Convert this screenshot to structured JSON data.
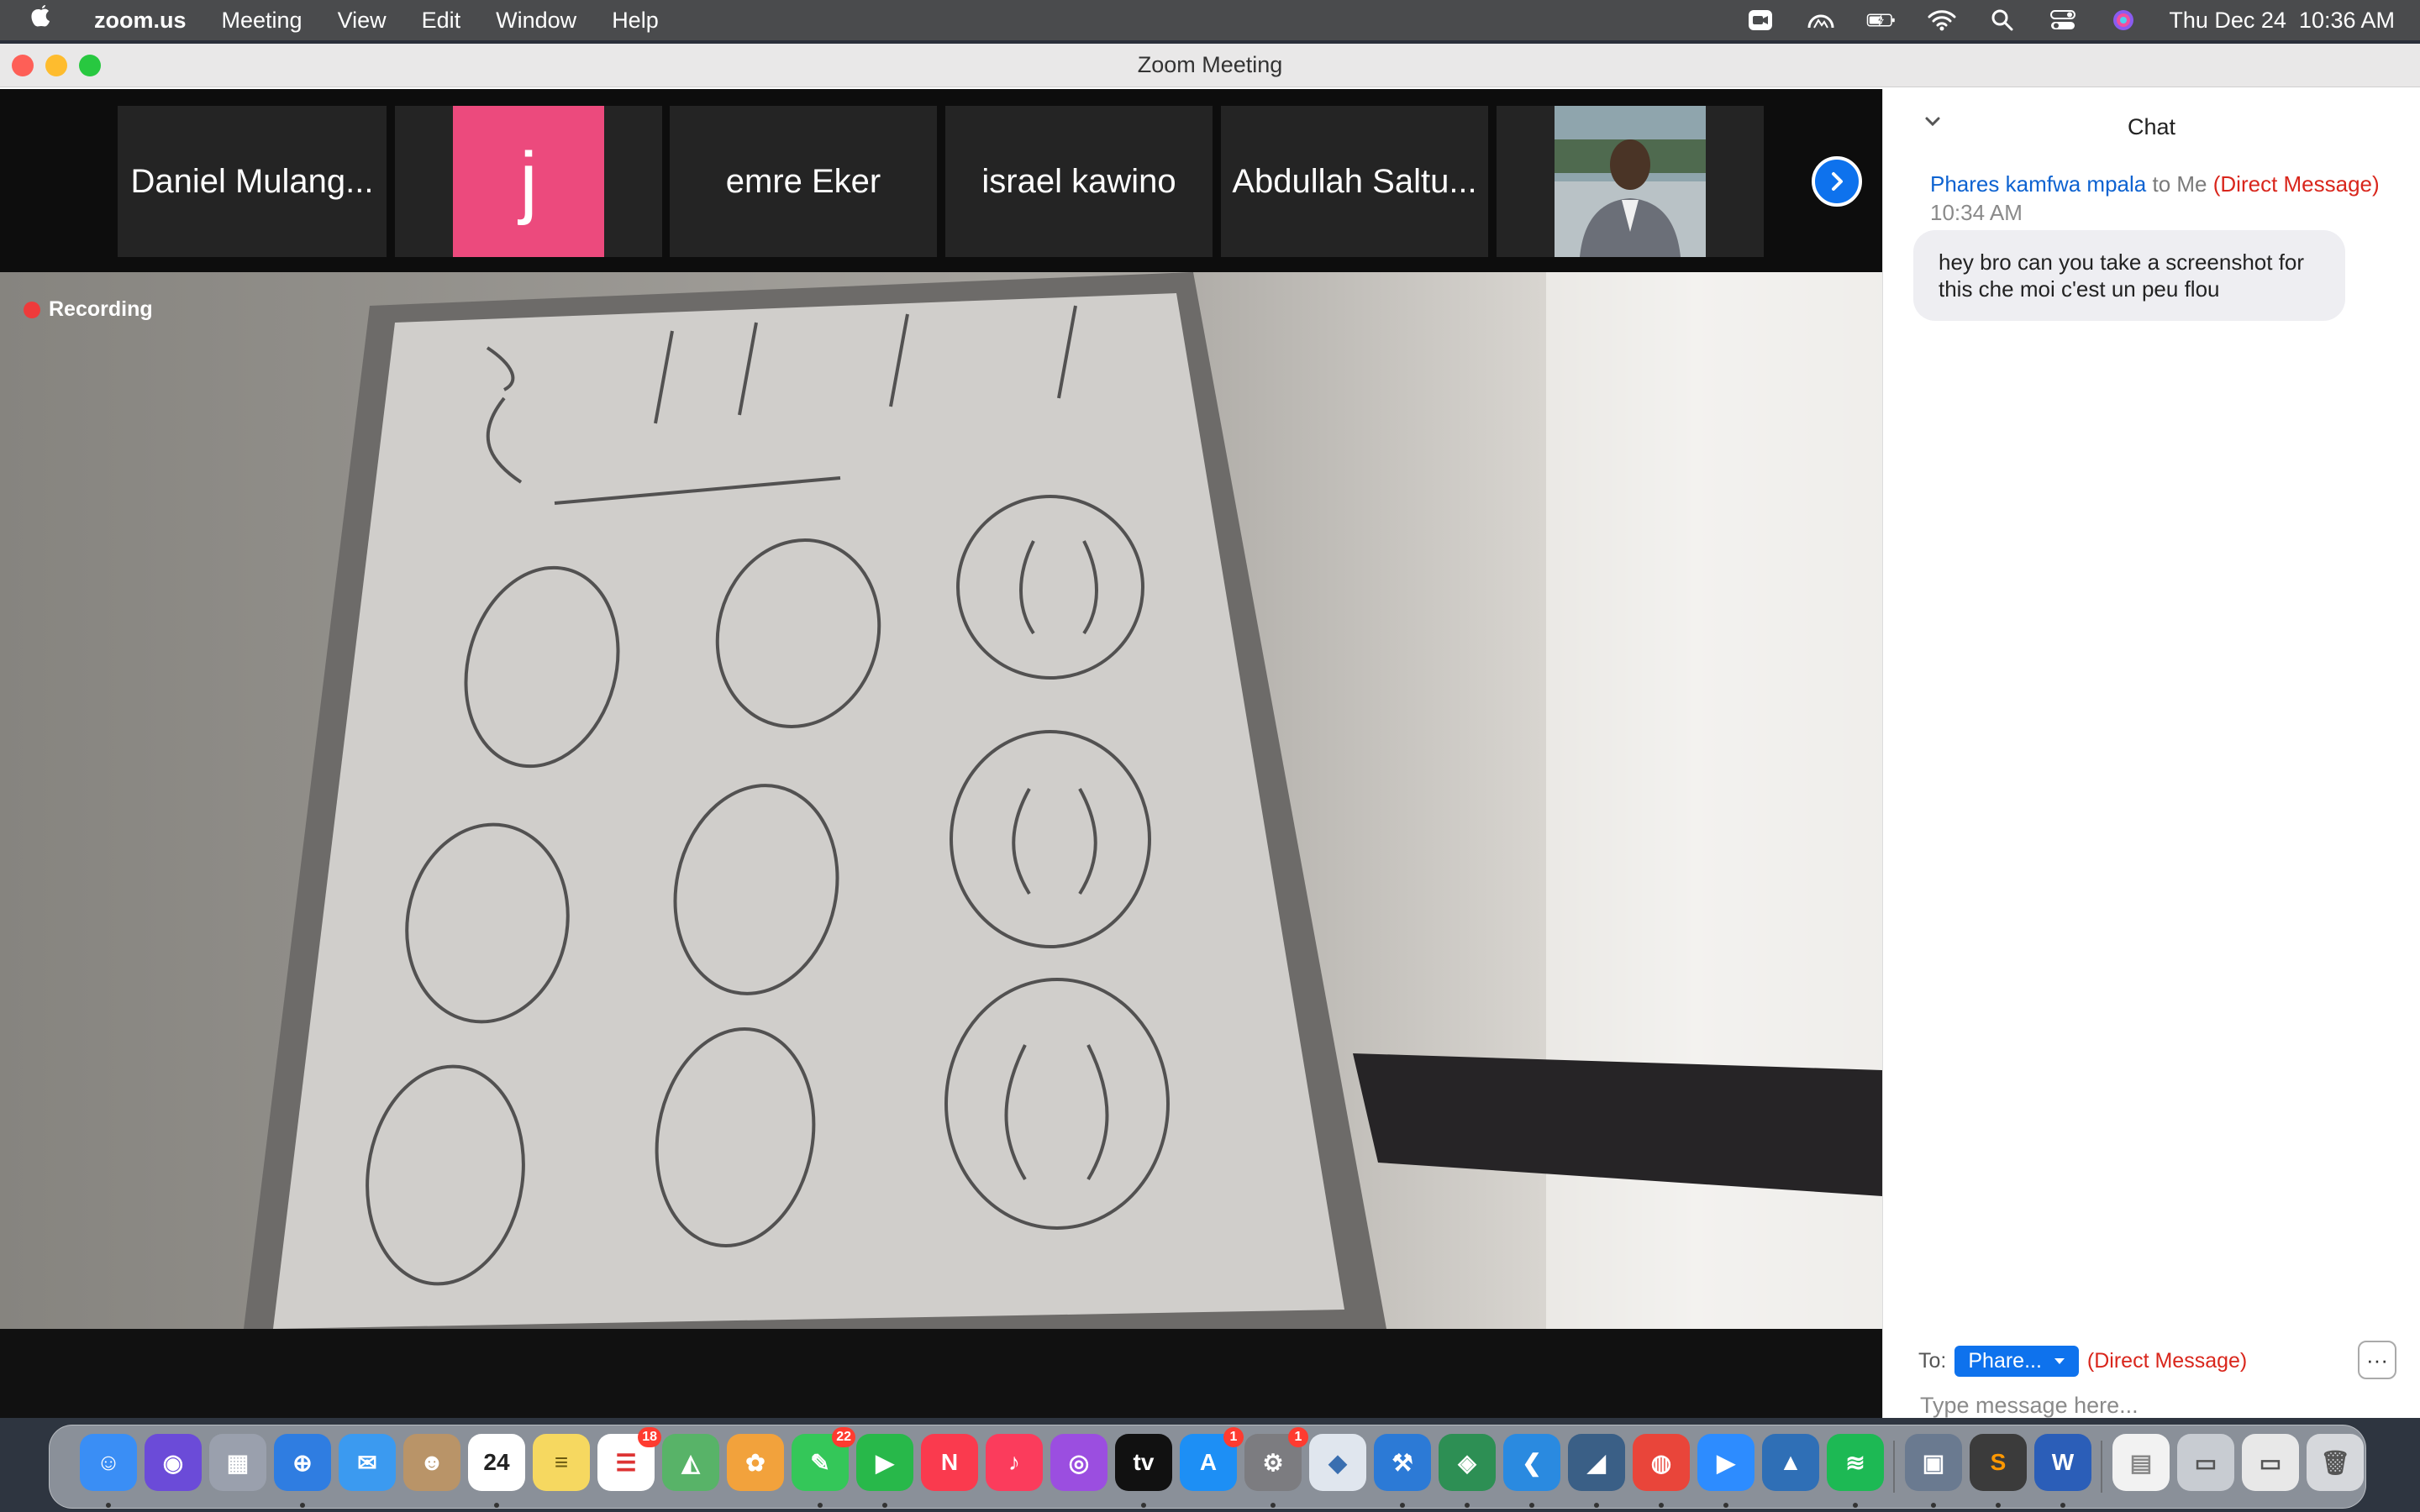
{
  "menubar": {
    "app_name": "zoom.us",
    "menus": [
      "Meeting",
      "View",
      "Edit",
      "Window",
      "Help"
    ],
    "datetime": "Thu Dec 24  10:36 AM"
  },
  "window": {
    "title": "Zoom Meeting"
  },
  "participants": [
    {
      "name": "Daniel Mulang..."
    },
    {
      "avatar_letter": "j",
      "avatar_color": "#ec4a7d"
    },
    {
      "name": "emre Eker"
    },
    {
      "name": "israel kawino"
    },
    {
      "name": "Abdullah Saltu..."
    }
  ],
  "video": {
    "recording_label": "Recording"
  },
  "chat": {
    "title": "Chat",
    "sender": "Phares kamfwa mpala",
    "to_me": "to Me",
    "direct": "(Direct Message)",
    "time": "10:34 AM",
    "message": "hey bro can you take a screenshot for this che moi c'est un peu flou",
    "to_label": "To:",
    "to_value": "Phare...",
    "to_direct": "(Direct Message)",
    "more": "···",
    "input_placeholder": "Type message here..."
  },
  "dock": {
    "items": [
      {
        "name": "finder",
        "color": "#3a8ef5",
        "glyph": "☺"
      },
      {
        "name": "siri",
        "color": "#6b4bd8",
        "glyph": "◉"
      },
      {
        "name": "launchpad",
        "color": "#9aa0ad",
        "glyph": "▦"
      },
      {
        "name": "safari",
        "color": "#2f7de1",
        "glyph": "⊕"
      },
      {
        "name": "mail",
        "color": "#3b9af0",
        "glyph": "✉"
      },
      {
        "name": "contacts",
        "color": "#b99468",
        "glyph": "☻"
      },
      {
        "name": "calendar",
        "color": "#ffffff",
        "glyph": "24",
        "text_color": "#222"
      },
      {
        "name": "notes",
        "color": "#f6d860",
        "glyph": "≡",
        "text_color": "#6b5a10"
      },
      {
        "name": "reminders",
        "color": "#ffffff",
        "glyph": "☰",
        "text_color": "#d33",
        "badge": "18"
      },
      {
        "name": "maps",
        "color": "#58b368",
        "glyph": "◭"
      },
      {
        "name": "photos",
        "color": "#f2a23c",
        "glyph": "✿"
      },
      {
        "name": "messages",
        "color": "#34c759",
        "glyph": "✎",
        "badge": "22"
      },
      {
        "name": "facetime",
        "color": "#28b84a",
        "glyph": "▶"
      },
      {
        "name": "news",
        "color": "#fa3a4e",
        "glyph": "N"
      },
      {
        "name": "music",
        "color": "#fb3c5c",
        "glyph": "♪"
      },
      {
        "name": "podcasts",
        "color": "#9b4ee0",
        "glyph": "◎"
      },
      {
        "name": "tv",
        "color": "#111111",
        "glyph": "tv"
      },
      {
        "name": "app-store",
        "color": "#1d8ff5",
        "glyph": "A",
        "badge": "1"
      },
      {
        "name": "system-preferences",
        "color": "#7c7c80",
        "glyph": "⚙",
        "badge": "1"
      },
      {
        "name": "virtualbox",
        "color": "#e0e6ee",
        "glyph": "◆",
        "text_color": "#3a6fb0"
      },
      {
        "name": "xcode",
        "color": "#2c7ad6",
        "glyph": "⚒"
      },
      {
        "name": "android-studio",
        "color": "#2d8f54",
        "glyph": "◈"
      },
      {
        "name": "vscode",
        "color": "#2a8ae0",
        "glyph": "❮"
      },
      {
        "name": "mysql-workbench",
        "color": "#3a5f86",
        "glyph": "◢"
      },
      {
        "name": "chrome",
        "color": "#e9453a",
        "glyph": "◍"
      },
      {
        "name": "zoom",
        "color": "#2d8cff",
        "glyph": "▶"
      },
      {
        "name": "vpn",
        "color": "#2f6fb6",
        "glyph": "▲"
      },
      {
        "name": "spotify",
        "color": "#1db954",
        "glyph": "≋"
      },
      {
        "name": "preview",
        "color": "#6a7a90",
        "glyph": "▣"
      },
      {
        "name": "sublime-text",
        "color": "#3b3b3b",
        "glyph": "S",
        "text_color": "#ff9800"
      },
      {
        "name": "word",
        "color": "#2b5eb8",
        "glyph": "W"
      },
      {
        "name": "document",
        "color": "#f2f2f2",
        "glyph": "▤",
        "text_color": "#888"
      },
      {
        "name": "screenshot",
        "color": "#c8ccd2",
        "glyph": "▭",
        "text_color": "#555"
      },
      {
        "name": "downloads-stack",
        "color": "#e8e8e8",
        "glyph": "▭",
        "text_color": "#555"
      },
      {
        "name": "trash",
        "color": "#d6d8dc",
        "glyph": "🗑",
        "text_color": "#555"
      }
    ]
  }
}
